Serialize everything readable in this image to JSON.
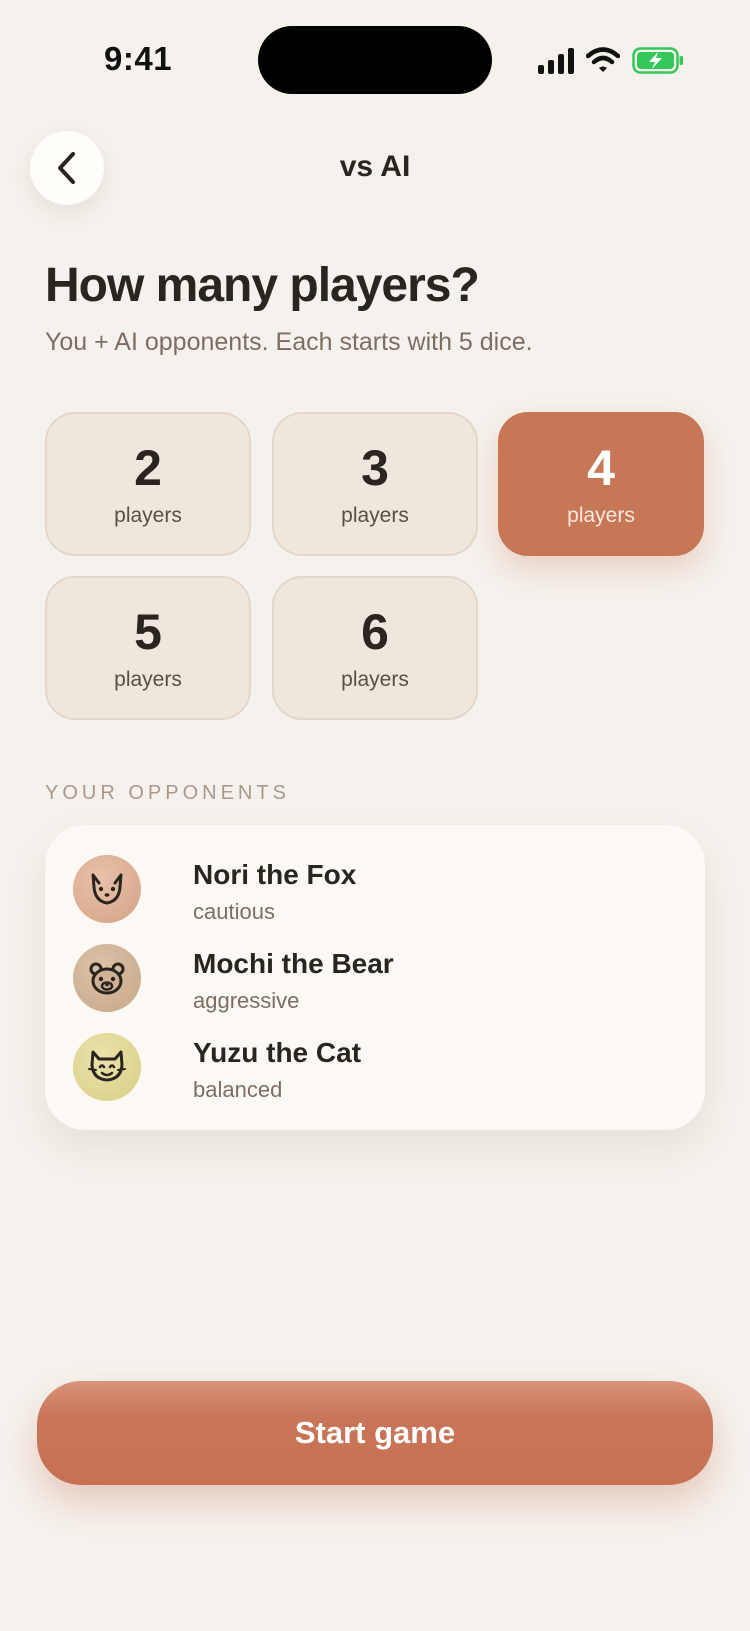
{
  "status_bar": {
    "time": "9:41"
  },
  "header": {
    "title": "vs AI"
  },
  "heading": "How many players?",
  "subheading": "You + AI opponents. Each starts with 5 dice.",
  "player_options": [
    {
      "number": "2",
      "label": "players",
      "selected": false
    },
    {
      "number": "3",
      "label": "players",
      "selected": false
    },
    {
      "number": "4",
      "label": "players",
      "selected": true
    },
    {
      "number": "5",
      "label": "players",
      "selected": false
    },
    {
      "number": "6",
      "label": "players",
      "selected": false
    }
  ],
  "opponents_section": {
    "label": "YOUR OPPONENTS",
    "opponents": [
      {
        "name": "Nori the Fox",
        "style": "cautious",
        "icon": "fox-icon",
        "color": "#dcae94"
      },
      {
        "name": "Mochi the Bear",
        "style": "aggressive",
        "icon": "bear-icon",
        "color": "#cfb196"
      },
      {
        "name": "Yuzu the Cat",
        "style": "balanced",
        "icon": "cat-icon",
        "color": "#ded597"
      }
    ]
  },
  "start_button": {
    "label": "Start game"
  },
  "colors": {
    "accent": "#c77656",
    "background": "#f5f1ec",
    "card": "#fcf9f5",
    "option": "#efe7de"
  }
}
